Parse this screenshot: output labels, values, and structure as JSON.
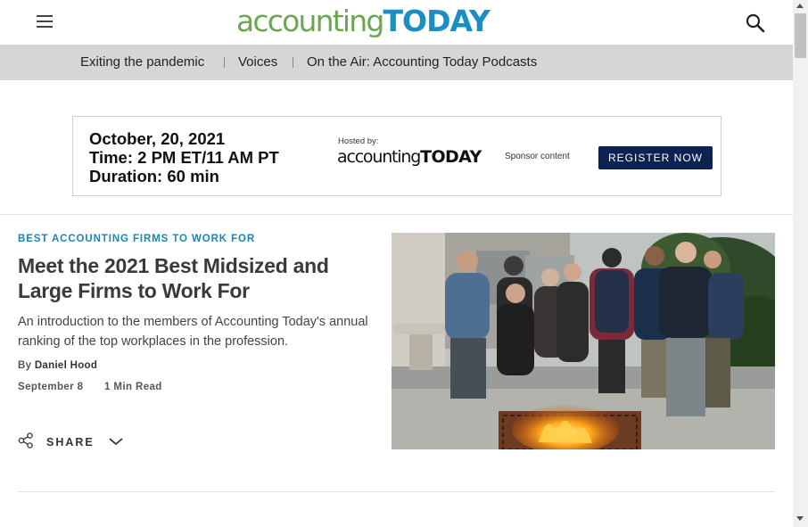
{
  "header": {
    "menu_icon": "hamburger-menu-icon",
    "logo_part1": "accounting",
    "logo_part2": "TODAY",
    "search_icon": "search-icon",
    "colors": {
      "logo_green": "#6aa84f",
      "logo_blue": "#1a8fc4"
    }
  },
  "nav": {
    "items": [
      {
        "label": "Exiting the pandemic"
      },
      {
        "label": "Voices"
      },
      {
        "label": "On the Air: Accounting Today Podcasts"
      }
    ]
  },
  "ad": {
    "line1": "October, 20, 2021",
    "line2": "Time: 2 PM ET/11 AM PT",
    "line3": "Duration: 60 min",
    "hosted_by": "Hosted by:",
    "logo_part1": "accounting",
    "logo_part2": "TODAY",
    "sponsor": "Sponsor content",
    "register": "REGISTER NOW",
    "colors": {
      "register_bg": "#0c2252"
    }
  },
  "article": {
    "kicker": "BEST ACCOUNTING FIRMS TO WORK FOR",
    "headline": "Meet the 2021 Best Midsized and Large Firms to Work For",
    "dek": "An introduction to the members of Accounting Today's annual ranking of the top workplaces in the profession.",
    "by": "By",
    "author": "Daniel Hood",
    "date": "September 8",
    "read_time": "1 Min Read",
    "share_label": "SHARE",
    "share_icon": "share-icon",
    "chevron_icon": "chevron-down-icon",
    "colors": {
      "kicker": "#1d84b5"
    }
  }
}
